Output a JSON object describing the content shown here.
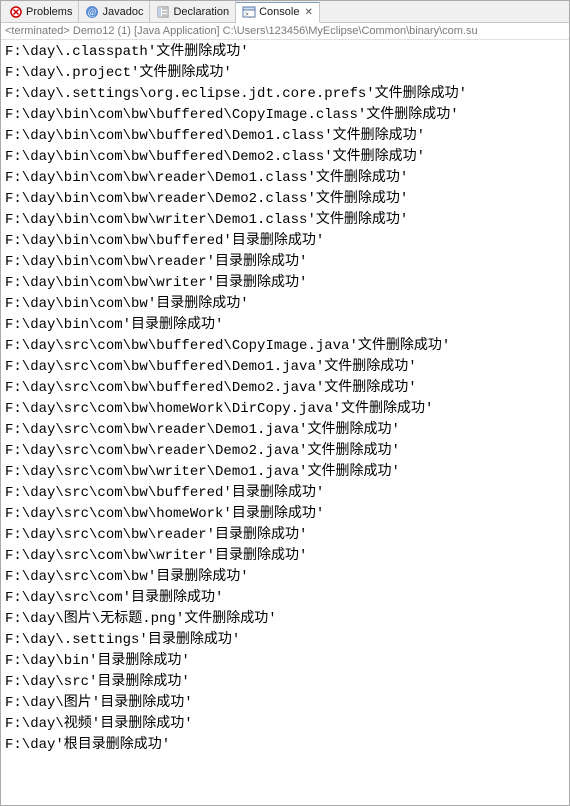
{
  "tabs": [
    {
      "label": "Problems"
    },
    {
      "label": "Javadoc"
    },
    {
      "label": "Declaration"
    },
    {
      "label": "Console"
    }
  ],
  "status": "<terminated> Demo12 (1) [Java Application] C:\\Users\\123456\\MyEclipse\\Common\\binary\\com.su",
  "console_lines": [
    "F:\\day\\.classpath'文件删除成功'",
    "F:\\day\\.project'文件删除成功'",
    "F:\\day\\.settings\\org.eclipse.jdt.core.prefs'文件删除成功'",
    "F:\\day\\bin\\com\\bw\\buffered\\CopyImage.class'文件删除成功'",
    "F:\\day\\bin\\com\\bw\\buffered\\Demo1.class'文件删除成功'",
    "F:\\day\\bin\\com\\bw\\buffered\\Demo2.class'文件删除成功'",
    "F:\\day\\bin\\com\\bw\\reader\\Demo1.class'文件删除成功'",
    "F:\\day\\bin\\com\\bw\\reader\\Demo2.class'文件删除成功'",
    "F:\\day\\bin\\com\\bw\\writer\\Demo1.class'文件删除成功'",
    "F:\\day\\bin\\com\\bw\\buffered'目录删除成功'",
    "F:\\day\\bin\\com\\bw\\reader'目录删除成功'",
    "F:\\day\\bin\\com\\bw\\writer'目录删除成功'",
    "F:\\day\\bin\\com\\bw'目录删除成功'",
    "F:\\day\\bin\\com'目录删除成功'",
    "F:\\day\\src\\com\\bw\\buffered\\CopyImage.java'文件删除成功'",
    "F:\\day\\src\\com\\bw\\buffered\\Demo1.java'文件删除成功'",
    "F:\\day\\src\\com\\bw\\buffered\\Demo2.java'文件删除成功'",
    "F:\\day\\src\\com\\bw\\homeWork\\DirCopy.java'文件删除成功'",
    "F:\\day\\src\\com\\bw\\reader\\Demo1.java'文件删除成功'",
    "F:\\day\\src\\com\\bw\\reader\\Demo2.java'文件删除成功'",
    "F:\\day\\src\\com\\bw\\writer\\Demo1.java'文件删除成功'",
    "F:\\day\\src\\com\\bw\\buffered'目录删除成功'",
    "F:\\day\\src\\com\\bw\\homeWork'目录删除成功'",
    "F:\\day\\src\\com\\bw\\reader'目录删除成功'",
    "F:\\day\\src\\com\\bw\\writer'目录删除成功'",
    "F:\\day\\src\\com\\bw'目录删除成功'",
    "F:\\day\\src\\com'目录删除成功'",
    "F:\\day\\图片\\无标题.png'文件删除成功'",
    "F:\\day\\.settings'目录删除成功'",
    "F:\\day\\bin'目录删除成功'",
    "F:\\day\\src'目录删除成功'",
    "F:\\day\\图片'目录删除成功'",
    "F:\\day\\视频'目录删除成功'",
    "F:\\day'根目录删除成功'"
  ]
}
